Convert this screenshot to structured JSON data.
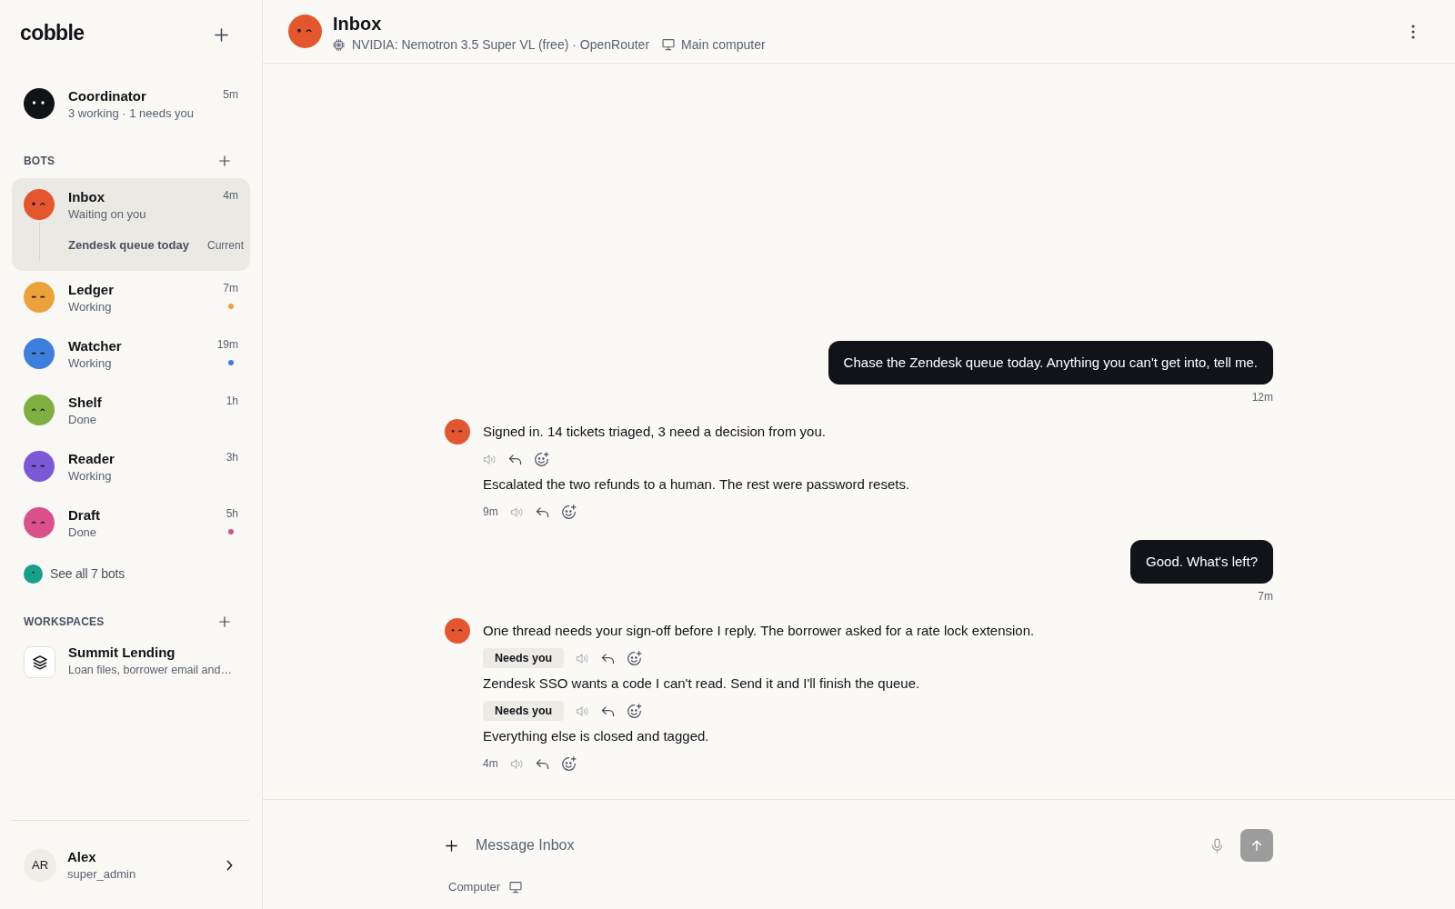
{
  "sidebar": {
    "logo": "cobble",
    "coordinator": {
      "name": "Coordinator",
      "status": "3 working · 1 needs you",
      "time": "5m"
    },
    "bots_heading": "BOTS",
    "bots": [
      {
        "name": "Inbox",
        "status": "Waiting on you",
        "time": "4m",
        "color": "#e4572e",
        "kind": "wink",
        "selected": true,
        "unread": false,
        "threads": [
          {
            "title": "Zendesk queue today",
            "label": "Current"
          }
        ]
      },
      {
        "name": "Ledger",
        "status": "Working",
        "time": "7m",
        "color": "#eba23b",
        "kind": "dashes",
        "selected": false,
        "unread": true
      },
      {
        "name": "Watcher",
        "status": "Working",
        "time": "19m",
        "color": "#3d7fdc",
        "kind": "dashes",
        "selected": false,
        "unread": true
      },
      {
        "name": "Shelf",
        "status": "Done",
        "time": "1h",
        "color": "#7eaf3f",
        "kind": "arcs",
        "selected": false,
        "unread": false
      },
      {
        "name": "Reader",
        "status": "Working",
        "time": "3h",
        "color": "#7a58d6",
        "kind": "dashes",
        "selected": false,
        "unread": false
      },
      {
        "name": "Draft",
        "status": "Done",
        "time": "5h",
        "color": "#d9508a",
        "kind": "arcs",
        "selected": false,
        "unread": true
      }
    ],
    "see_all": "See all 7 bots",
    "workspaces_heading": "WORKSPACES",
    "workspaces": [
      {
        "name": "Summit Lending",
        "description": "Loan files, borrower email and…"
      }
    ],
    "user": {
      "initials": "AR",
      "name": "Alex",
      "role": "super_admin"
    }
  },
  "header": {
    "title": "Inbox",
    "model": "NVIDIA: Nemotron 3.5 Super VL (free) · OpenRouter",
    "computer": "Main computer"
  },
  "messages": [
    {
      "kind": "user",
      "text": "Chase the Zendesk queue today. Anything you can't get into, tell me.",
      "time": "12m"
    },
    {
      "kind": "bot",
      "parts": [
        {
          "text": "Signed in. 14 tickets triaged, 3 need a decision from you."
        },
        {
          "text": "Escalated the two refunds to a human. The rest were password resets.",
          "time": "9m"
        }
      ]
    },
    {
      "kind": "user",
      "text": "Good. What's left?",
      "time": "7m"
    },
    {
      "kind": "bot",
      "parts": [
        {
          "text": "One thread needs your sign-off before I reply. The borrower asked for a rate lock extension.",
          "badge": "Needs you"
        },
        {
          "text": "Zendesk SSO wants a code I can't read. Send it and I'll finish the queue.",
          "badge": "Needs you"
        },
        {
          "text": "Everything else is closed and tagged.",
          "time": "4m"
        }
      ]
    }
  ],
  "composer": {
    "placeholder": "Message Inbox",
    "send_disabled": true,
    "target": "Computer"
  }
}
